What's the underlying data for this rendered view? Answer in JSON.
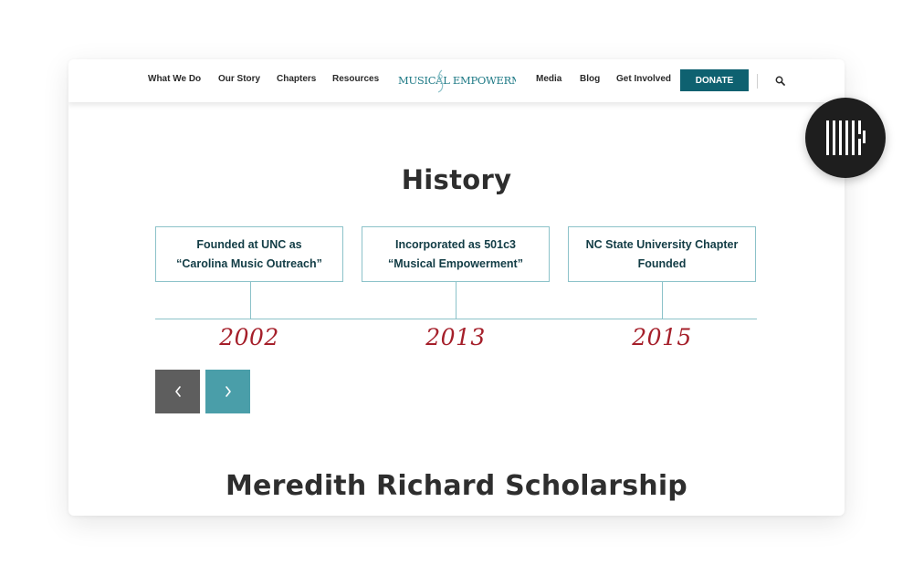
{
  "nav": {
    "left_links": [
      "What We Do",
      "Our Story",
      "Chapters",
      "Resources"
    ],
    "logo_text": "MUSICAL EMPOWERMENT",
    "right_links": [
      "Media",
      "Blog",
      "Get Involved"
    ],
    "donate_label": "DONATE",
    "search_icon": "search-icon"
  },
  "history": {
    "title": "History",
    "events": [
      {
        "text_line1": "Founded at UNC as",
        "text_line2": "“Carolina Music Outreach”",
        "year": "2002"
      },
      {
        "text_line1": "Incorporated as 501c3",
        "text_line2": "“Musical Empowerment”",
        "year": "2013"
      },
      {
        "text_line1": "NC State University Chapter",
        "text_line2": "Founded",
        "year": "2015"
      }
    ],
    "prev_icon": "chevron-left-icon",
    "next_icon": "chevron-right-icon"
  },
  "scholarship": {
    "title": "Meredith Richard Scholarship"
  },
  "colors": {
    "brand_teal": "#0e6170",
    "accent_teal": "#4a9ea9",
    "year_red": "#a51f2a",
    "timeline_line": "#8cc2c9",
    "badge_bg": "#1e1e1e"
  }
}
